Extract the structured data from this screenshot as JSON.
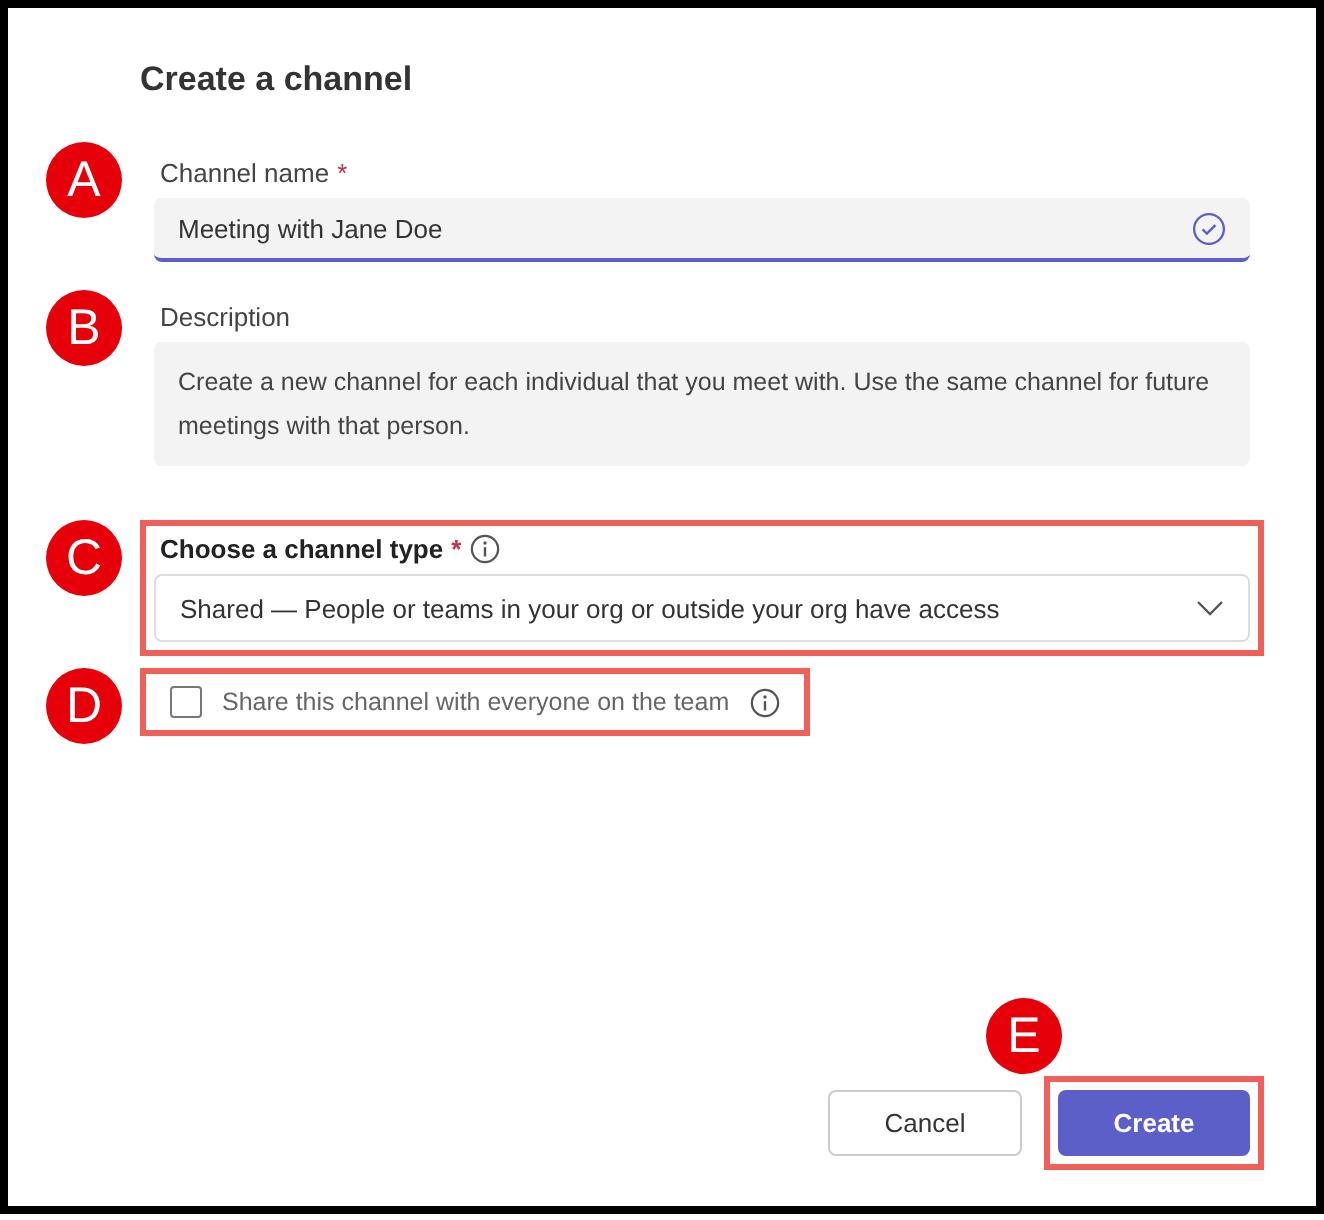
{
  "dialog": {
    "title": "Create a channel"
  },
  "channel_name": {
    "badge": "A",
    "label": "Channel name",
    "required_mark": "*",
    "value": "Meeting with Jane Doe",
    "valid": true
  },
  "description": {
    "badge": "B",
    "label": "Description",
    "value": "Create a new channel for each individual that you meet with. Use the same channel for future meetings with that person."
  },
  "channel_type": {
    "badge": "C",
    "label": "Choose a channel type",
    "required_mark": "*",
    "value": "Shared — People or teams in your org or outside your org have access",
    "highlighted": true
  },
  "share_option": {
    "badge": "D",
    "label": "Share this channel with everyone on the team",
    "checked": false,
    "highlighted": true
  },
  "buttons": [
    {
      "label": "Cancel",
      "kind": "secondary",
      "highlighted": false
    },
    {
      "label": "Create",
      "kind": "primary",
      "highlighted": true,
      "badge": "E"
    }
  ]
}
